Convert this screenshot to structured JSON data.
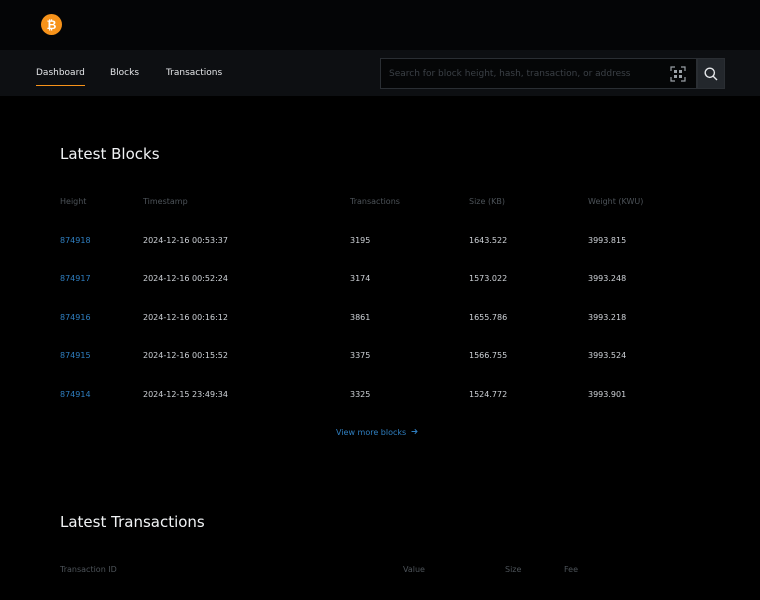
{
  "header": {
    "logo_icon": "bitcoin-icon",
    "brand_color": "#f7931a"
  },
  "nav": {
    "items": [
      {
        "label": "Dashboard",
        "active": true
      },
      {
        "label": "Blocks",
        "active": false
      },
      {
        "label": "Transactions",
        "active": false
      }
    ]
  },
  "search": {
    "placeholder": "Search for block height, hash, transaction, or address",
    "value": "",
    "scan_icon": "qr-scan-icon",
    "search_icon": "search-icon"
  },
  "latest_blocks": {
    "title": "Latest Blocks",
    "columns": [
      "Height",
      "Timestamp",
      "Transactions",
      "Size (KB)",
      "Weight (KWU)"
    ],
    "rows": [
      [
        "874918",
        "2024-12-16 00:53:37",
        "3195",
        "1643.522",
        "3993.815"
      ],
      [
        "874917",
        "2024-12-16 00:52:24",
        "3174",
        "1573.022",
        "3993.248"
      ],
      [
        "874916",
        "2024-12-16 00:16:12",
        "3861",
        "1655.786",
        "3993.218"
      ],
      [
        "874915",
        "2024-12-16 00:15:52",
        "3375",
        "1566.755",
        "3993.524"
      ],
      [
        "874914",
        "2024-12-15 23:49:34",
        "3325",
        "1524.772",
        "3993.901"
      ]
    ],
    "view_more": "View more blocks",
    "link_color": "#2f7fc1"
  },
  "latest_transactions": {
    "title": "Latest Transactions",
    "columns": [
      "Transaction ID",
      "Value",
      "Size",
      "Fee"
    ]
  }
}
